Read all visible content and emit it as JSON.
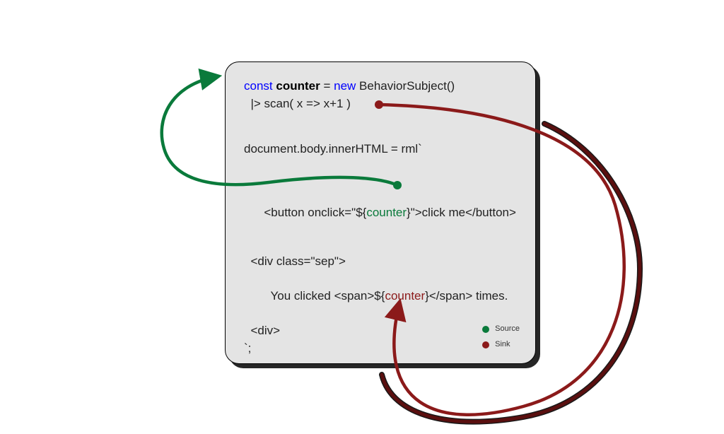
{
  "colors": {
    "keyword_blue": "#0000ff",
    "source_green": "#0a7a3b",
    "sink_red": "#8b1a1a",
    "box_bg": "#e4e4e4",
    "box_border": "#000000"
  },
  "legend": {
    "source_label": "Source",
    "sink_label": "Sink"
  },
  "code": {
    "line1": {
      "kw_const": "const",
      "ident_counter": "counter",
      "equals": " = ",
      "kw_new": "new",
      "ctor": " BehaviorSubject()"
    },
    "line2": "  |> scan( x => x+1 )",
    "line3": "document.body.innerHTML = rml`",
    "button": {
      "prefix": "  <button onclick=\"${",
      "source_ref": "counter",
      "suffix": "}\">click me</button>"
    },
    "div_open": "  <div class=\"sep\">",
    "clicked": {
      "prefix": "    You clicked <span>${",
      "sink_ref": "counter",
      "suffix": "}</span> times."
    },
    "div_close": "  <div>",
    "template_end": "`;"
  }
}
